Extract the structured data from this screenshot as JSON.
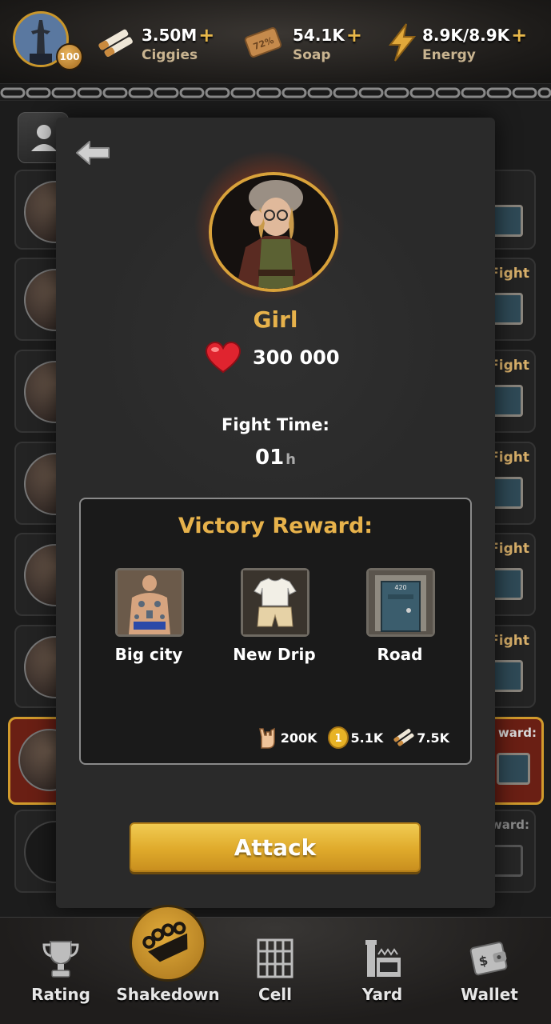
{
  "header": {
    "level": "100",
    "resources": [
      {
        "value": "3.50M",
        "label": "Ciggies",
        "icon": "cigarettes-icon"
      },
      {
        "value": "54.1K",
        "label": "Soap",
        "icon": "soap-icon",
        "icon_text": "72%"
      },
      {
        "value": "8.9K/8.9K",
        "label": "Energy",
        "icon": "lightning-icon"
      }
    ],
    "plus": "+"
  },
  "background_rows": {
    "fight_label": "Fight",
    "reward_label": "ward:"
  },
  "modal": {
    "enemy_name": "Girl",
    "hp": "300 000",
    "fight_time_label": "Fight Time:",
    "fight_time_value": "01",
    "fight_time_unit": "h",
    "reward": {
      "title": "Victory Reward:",
      "items": [
        {
          "name": "Big city",
          "icon": "tattooed-man-icon"
        },
        {
          "name": "New Drip",
          "icon": "shirt-icon"
        },
        {
          "name": "Road",
          "icon": "door-icon",
          "icon_text": "420"
        }
      ],
      "totals": [
        {
          "value": "200K",
          "icon": "rock-hand-icon"
        },
        {
          "value": "5.1K",
          "icon": "coin-icon"
        },
        {
          "value": "7.5K",
          "icon": "cigarettes-icon"
        }
      ]
    },
    "attack_label": "Attack"
  },
  "nav": {
    "items": [
      {
        "label": "Rating",
        "icon": "trophy-icon"
      },
      {
        "label": "Shakedown",
        "icon": "brass-knuckles-icon"
      },
      {
        "label": "Cell",
        "icon": "cell-bars-icon"
      },
      {
        "label": "Yard",
        "icon": "watchtower-icon"
      },
      {
        "label": "Wallet",
        "icon": "wallet-icon"
      }
    ]
  },
  "colors": {
    "accent": "#e7b24b",
    "button": "#dfaa2b",
    "active_row": "#6a1f14"
  }
}
